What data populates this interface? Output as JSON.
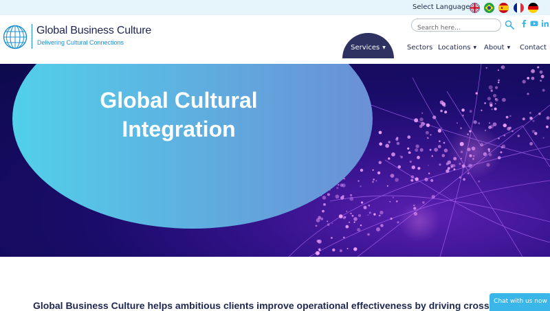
{
  "topbar": {
    "language_label": "Select Language |",
    "languages": [
      "English",
      "Portuguese",
      "Spanish",
      "French",
      "German"
    ]
  },
  "brand": {
    "name": "Global Business Culture",
    "tagline": "Delivering Cultural Connections"
  },
  "search": {
    "placeholder": "Search here...",
    "value": ""
  },
  "social": [
    "facebook-icon",
    "youtube-icon",
    "linkedin-icon"
  ],
  "nav": {
    "services": "Services",
    "sectors": "Sectors",
    "locations": "Locations",
    "about": "About",
    "contact": "Contact"
  },
  "hero": {
    "title": "Global Cultural Integration"
  },
  "lead_text": "Global Business Culture helps ambitious clients improve operational effectiveness by driving cross-cu",
  "chat": {
    "label": "Chat with us now"
  },
  "colors": {
    "brand_navy": "#1d2650",
    "brand_blue": "#1a8fd1",
    "topbar_bg": "#e6f4fb",
    "nav_active": "#2d3261",
    "chat_bg": "#3ab6e8"
  }
}
